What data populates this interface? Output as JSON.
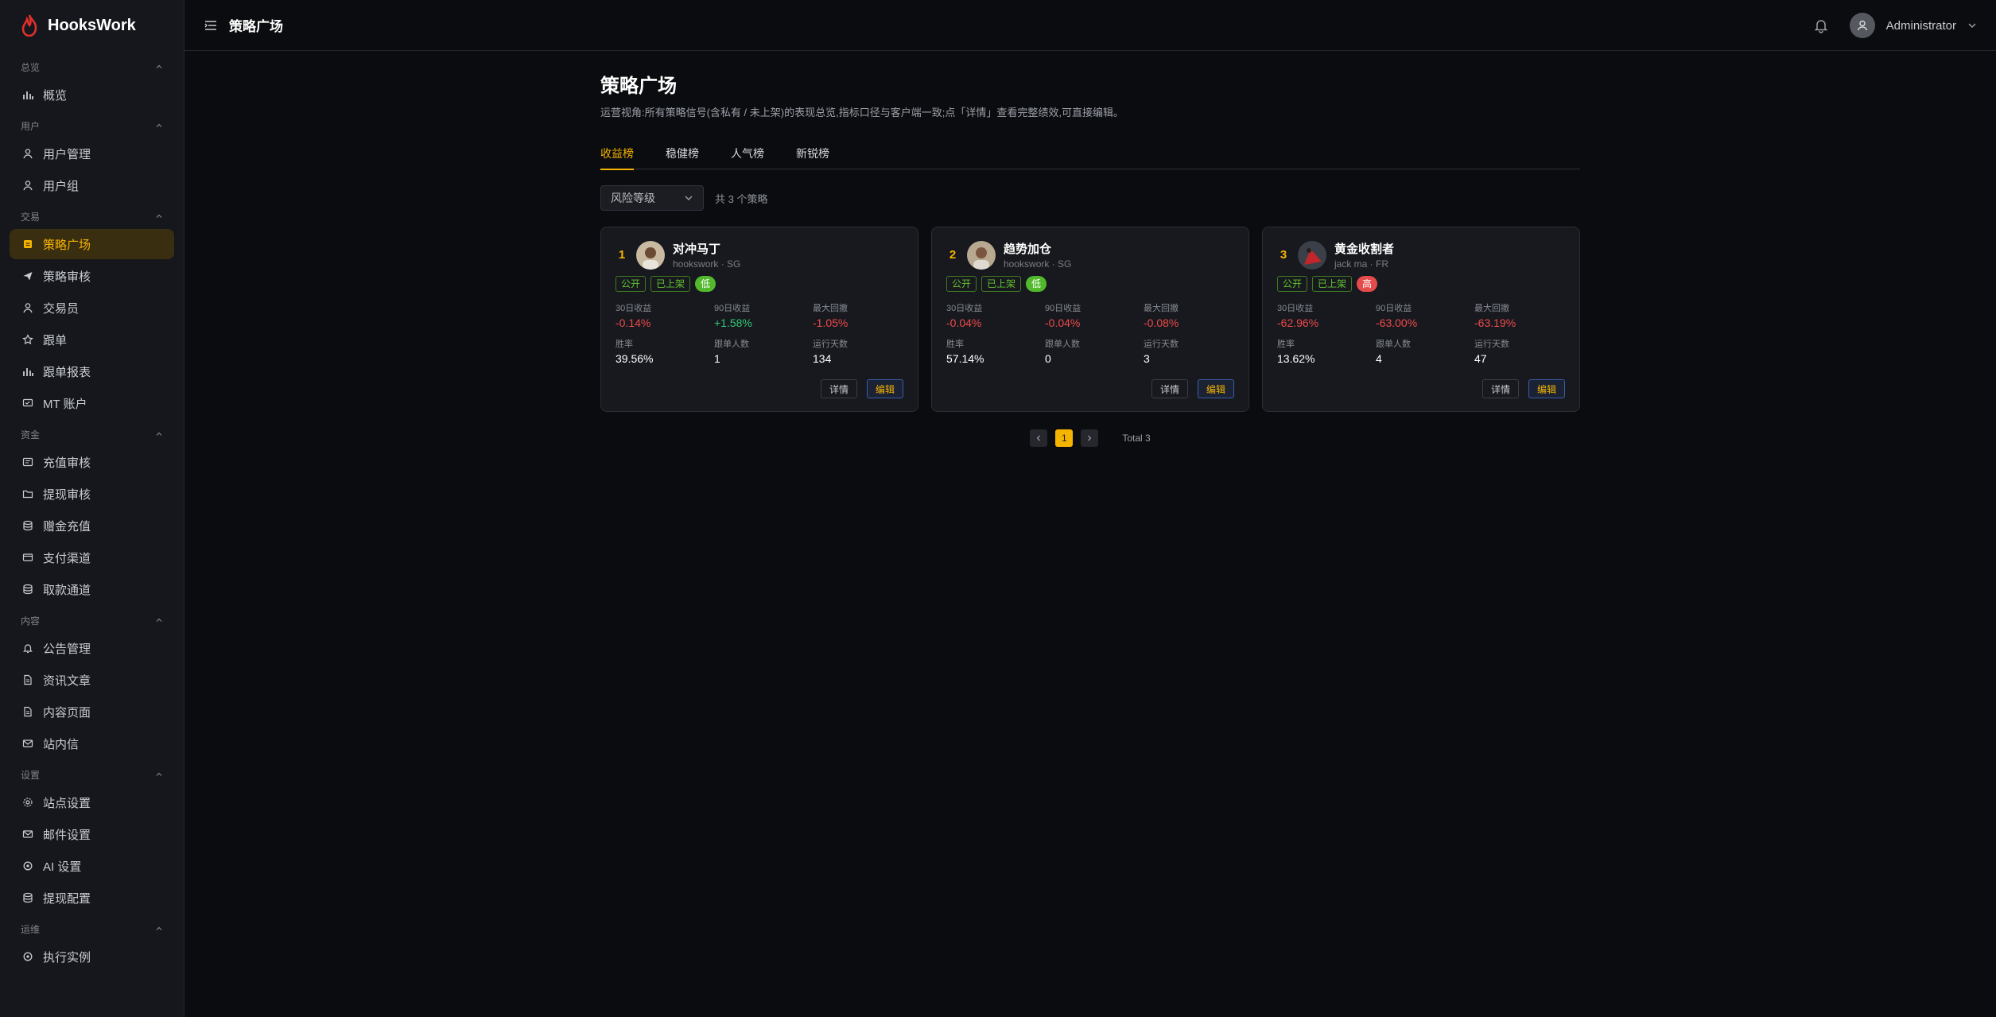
{
  "brand": {
    "name": "HooksWork"
  },
  "sidebar": {
    "groups": [
      {
        "title": "总览",
        "items": [
          {
            "label": "概览",
            "icon": "bar-chart-icon"
          }
        ]
      },
      {
        "title": "用户",
        "items": [
          {
            "label": "用户管理",
            "icon": "user-icon"
          },
          {
            "label": "用户组",
            "icon": "user-icon"
          }
        ]
      },
      {
        "title": "交易",
        "items": [
          {
            "label": "策略广场",
            "icon": "square-icon",
            "active": true
          },
          {
            "label": "策略审核",
            "icon": "send-icon"
          },
          {
            "label": "交易员",
            "icon": "user-icon"
          },
          {
            "label": "跟单",
            "icon": "star-icon"
          },
          {
            "label": "跟单报表",
            "icon": "bar-chart-icon"
          },
          {
            "label": "MT 账户",
            "icon": "monitor-icon"
          }
        ]
      },
      {
        "title": "资金",
        "items": [
          {
            "label": "充值审核",
            "icon": "receipt-icon"
          },
          {
            "label": "提现审核",
            "icon": "folder-icon"
          },
          {
            "label": "赠金充值",
            "icon": "coins-icon"
          },
          {
            "label": "支付渠道",
            "icon": "card-icon"
          },
          {
            "label": "取款通道",
            "icon": "coins-icon"
          }
        ]
      },
      {
        "title": "内容",
        "items": [
          {
            "label": "公告管理",
            "icon": "bell-icon"
          },
          {
            "label": "资讯文章",
            "icon": "document-icon"
          },
          {
            "label": "内容页面",
            "icon": "document-icon"
          },
          {
            "label": "站内信",
            "icon": "mail-icon"
          }
        ]
      },
      {
        "title": "设置",
        "items": [
          {
            "label": "站点设置",
            "icon": "gear-icon"
          },
          {
            "label": "邮件设置",
            "icon": "mail-icon"
          },
          {
            "label": "AI 设置",
            "icon": "circle-icon"
          },
          {
            "label": "提现配置",
            "icon": "coins-icon"
          }
        ]
      },
      {
        "title": "运维",
        "items": [
          {
            "label": "执行实例",
            "icon": "circle-icon"
          }
        ]
      }
    ]
  },
  "header": {
    "title": "策略广场",
    "user": "Administrator"
  },
  "page": {
    "title": "策略广场",
    "description": "运营视角:所有策略信号(含私有 / 未上架)的表现总览,指标口径与客户端一致;点「详情」查看完整绩效,可直接编辑。",
    "tabs": [
      "收益榜",
      "稳健榜",
      "人气榜",
      "新锐榜"
    ],
    "active_tab": 0,
    "filter_select": "风险等级",
    "count_text": "共 3 个策略"
  },
  "metric_labels": {
    "r30": "30日收益",
    "r90": "90日收益",
    "dd": "最大回撤",
    "win": "胜率",
    "followers": "跟单人数",
    "days": "运行天数"
  },
  "buttons": {
    "detail": "详情",
    "edit": "编辑"
  },
  "cards": [
    {
      "rank": "1",
      "name": "对冲马丁",
      "sub": "hookswork · SG",
      "tags": [
        "公开",
        "已上架"
      ],
      "risk": "低",
      "risk_level": "low",
      "r30": "-0.14%",
      "r90": "+1.58%",
      "dd": "-1.05%",
      "win": "39.56%",
      "followers": "1",
      "days": "134"
    },
    {
      "rank": "2",
      "name": "趋势加仓",
      "sub": "hookswork · SG",
      "tags": [
        "公开",
        "已上架"
      ],
      "risk": "低",
      "risk_level": "low",
      "r30": "-0.04%",
      "r90": "-0.04%",
      "dd": "-0.08%",
      "win": "57.14%",
      "followers": "0",
      "days": "3"
    },
    {
      "rank": "3",
      "name": "黄金收割者",
      "sub": "jack ma · FR",
      "tags": [
        "公开",
        "已上架"
      ],
      "risk": "高",
      "risk_level": "high",
      "r30": "-62.96%",
      "r90": "-63.00%",
      "dd": "-63.19%",
      "win": "13.62%",
      "followers": "4",
      "days": "47"
    }
  ],
  "pagination": {
    "current": "1",
    "total_text": "Total 3"
  },
  "colors": {
    "accent": "#f5b400",
    "negative": "#f04a4a",
    "positive": "#35c776"
  }
}
